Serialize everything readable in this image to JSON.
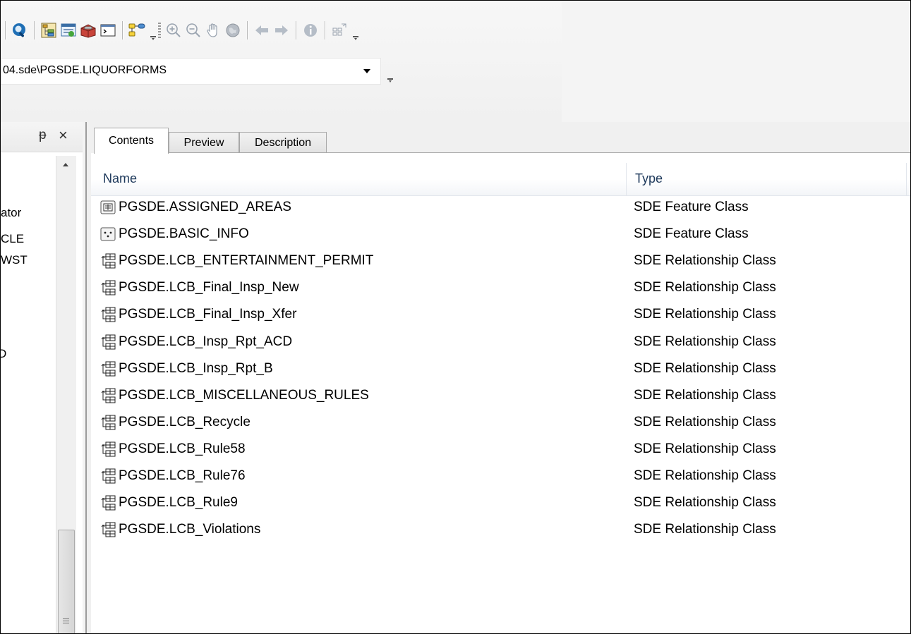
{
  "path_combo": {
    "value": "04.sde\\PGSDE.LIQUORFORMS"
  },
  "toolbar": {
    "buttons": [
      "search-window-icon",
      "catalog-tree-icon",
      "arccatalog-window-icon",
      "arctoolbox-icon",
      "python-window-icon",
      "model-builder-icon",
      "zoom-in-icon",
      "zoom-out-icon",
      "pan-icon",
      "full-extent-icon",
      "back-icon",
      "forward-icon",
      "identify-icon",
      "create-thumbnail-icon"
    ]
  },
  "left_pane": {
    "tree_items": [
      "ator",
      "CLE",
      "WST",
      "D"
    ]
  },
  "tabs": [
    {
      "label": "Contents",
      "active": true
    },
    {
      "label": "Preview",
      "active": false
    },
    {
      "label": "Description",
      "active": false
    }
  ],
  "columns": {
    "name": "Name",
    "type": "Type"
  },
  "rows": [
    {
      "name": "PGSDE.ASSIGNED_AREAS",
      "type": "SDE Feature Class",
      "icon": "polygon-feature-class-icon"
    },
    {
      "name": "PGSDE.BASIC_INFO",
      "type": "SDE Feature Class",
      "icon": "point-feature-class-icon"
    },
    {
      "name": "PGSDE.LCB_ENTERTAINMENT_PERMIT",
      "type": "SDE Relationship Class",
      "icon": "relationship-class-icon"
    },
    {
      "name": "PGSDE.LCB_Final_Insp_New",
      "type": "SDE Relationship Class",
      "icon": "relationship-class-icon"
    },
    {
      "name": "PGSDE.LCB_Final_Insp_Xfer",
      "type": "SDE Relationship Class",
      "icon": "relationship-class-icon"
    },
    {
      "name": "PGSDE.LCB_Insp_Rpt_ACD",
      "type": "SDE Relationship Class",
      "icon": "relationship-class-icon"
    },
    {
      "name": "PGSDE.LCB_Insp_Rpt_B",
      "type": "SDE Relationship Class",
      "icon": "relationship-class-icon"
    },
    {
      "name": "PGSDE.LCB_MISCELLANEOUS_RULES",
      "type": "SDE Relationship Class",
      "icon": "relationship-class-icon"
    },
    {
      "name": "PGSDE.LCB_Recycle",
      "type": "SDE Relationship Class",
      "icon": "relationship-class-icon"
    },
    {
      "name": "PGSDE.LCB_Rule58",
      "type": "SDE Relationship Class",
      "icon": "relationship-class-icon"
    },
    {
      "name": "PGSDE.LCB_Rule76",
      "type": "SDE Relationship Class",
      "icon": "relationship-class-icon"
    },
    {
      "name": "PGSDE.LCB_Rule9",
      "type": "SDE Relationship Class",
      "icon": "relationship-class-icon"
    },
    {
      "name": "PGSDE.LCB_Violations",
      "type": "SDE Relationship Class",
      "icon": "relationship-class-icon"
    }
  ]
}
